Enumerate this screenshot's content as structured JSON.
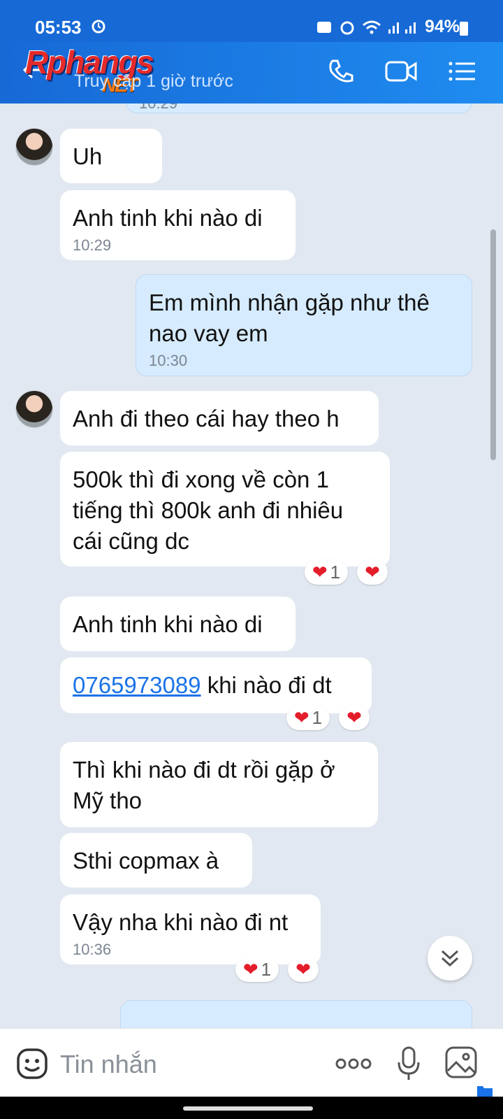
{
  "status": {
    "time": "05:53",
    "battery": "94%"
  },
  "header": {
    "logo_main": "Rphangs",
    "logo_sub": "NET",
    "subtitle": "Truy cập 1 giờ trước"
  },
  "messages": [
    {
      "text": "Uh"
    },
    {
      "text": "Anh tinh khi nào di",
      "time": "10:29"
    },
    {
      "text": "Em mình nhận gặp như thê nao vay em",
      "time": "10:30",
      "direction": "outgoing"
    },
    {
      "text": "Anh đi theo cái hay theo h"
    },
    {
      "text": "500k thì đi xong về còn 1 tiếng thì 800k anh đi nhiêu cái cũng dc",
      "reaction_count": "1"
    },
    {
      "text": "Anh tinh khi nào di"
    },
    {
      "phone": "0765973089",
      "text": " khi nào đi dt",
      "reaction_count": "1"
    },
    {
      "text": "Thì khi nào đi dt rồi gặp ở Mỹ tho"
    },
    {
      "text": "Sthi copmax à"
    },
    {
      "text": "Vậy nha khi nào đi nt",
      "time": "10:36",
      "reaction_count": "1"
    }
  ],
  "partial_top": {
    "time": "10:29"
  },
  "input": {
    "placeholder": "Tin nhắn"
  },
  "icons": {
    "heart": "❤",
    "back": "back-arrow-icon",
    "phone": "phone-icon",
    "video": "video-call-icon",
    "menu": "menu-list-icon",
    "emoji": "emoji-icon",
    "more": "more-dots-icon",
    "mic": "microphone-icon",
    "image": "image-gallery-icon"
  }
}
